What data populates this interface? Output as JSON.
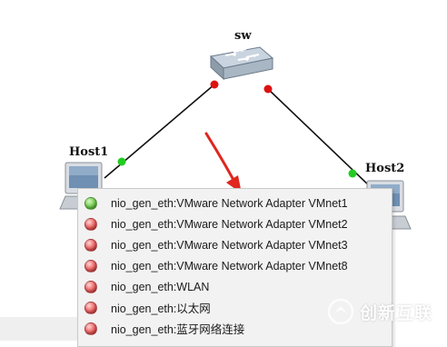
{
  "topology": {
    "switch": {
      "label": "sw"
    },
    "hosts": [
      {
        "label": "Host1"
      },
      {
        "label": "Host2"
      }
    ],
    "link_status_colors": {
      "up": "#22cc22",
      "down": "#dd1111"
    }
  },
  "adapter_menu": {
    "items": [
      {
        "label": "nio_gen_eth:VMware Network Adapter VMnet1",
        "status": "up"
      },
      {
        "label": "nio_gen_eth:VMware Network Adapter VMnet2",
        "status": "down"
      },
      {
        "label": "nio_gen_eth:VMware Network Adapter VMnet3",
        "status": "down"
      },
      {
        "label": "nio_gen_eth:VMware Network Adapter VMnet8",
        "status": "down"
      },
      {
        "label": "nio_gen_eth:WLAN",
        "status": "down"
      },
      {
        "label": "nio_gen_eth:以太网",
        "status": "down"
      },
      {
        "label": "nio_gen_eth:蓝牙网络连接",
        "status": "down"
      }
    ]
  },
  "watermark": {
    "text": "创新互联",
    "icon": "logo-icon"
  }
}
